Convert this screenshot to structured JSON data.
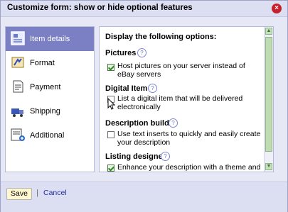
{
  "dialog": {
    "title": "Customize form: show or hide optional features",
    "close_icon": "close-icon"
  },
  "sidebar": {
    "items": [
      {
        "label": "Item details",
        "icon": "item-details-icon"
      },
      {
        "label": "Format",
        "icon": "format-icon"
      },
      {
        "label": "Payment",
        "icon": "payment-icon"
      },
      {
        "label": "Shipping",
        "icon": "shipping-icon"
      },
      {
        "label": "Additional",
        "icon": "additional-icon"
      }
    ]
  },
  "panel": {
    "heading": "Display the following options:",
    "sections": [
      {
        "title": "Pictures",
        "option": "Host pictures on your server instead of eBay servers",
        "checked": true
      },
      {
        "title": "Digital Item",
        "option": "List a digital item that will be delivered electronically",
        "checked": false
      },
      {
        "title": "Description builder",
        "option": "Use text inserts to quickly and easily create your description",
        "checked": false
      },
      {
        "title": "Listing designer",
        "option": "Enhance your description with a theme and",
        "checked": true
      }
    ],
    "help_icon": "help-icon"
  },
  "footer": {
    "save_label": "Save",
    "separator": "|",
    "cancel_label": "Cancel"
  }
}
